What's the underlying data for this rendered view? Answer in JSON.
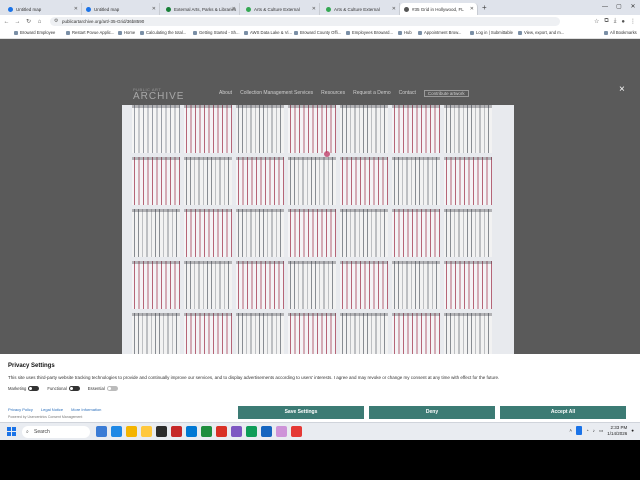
{
  "browser": {
    "tabs": [
      {
        "label": "Untitled map",
        "icon": "maps-icon",
        "color": "#1a73e8",
        "active": false
      },
      {
        "label": "Untitled map",
        "icon": "maps-icon",
        "color": "#1a73e8",
        "active": false
      },
      {
        "label": "External Arts, Parks & Libraries",
        "icon": "sheets-icon",
        "color": "#188038",
        "active": false
      },
      {
        "label": "Arts & Culture External",
        "icon": "sheets-icon",
        "color": "#34a853",
        "active": false
      },
      {
        "label": "Arts & Culture External",
        "icon": "sheets-icon",
        "color": "#34a853",
        "active": false
      },
      {
        "label": "#35 Grid in Hollywood, FL",
        "icon": "page-icon",
        "color": "#555555",
        "active": true
      }
    ],
    "url": "publicartarchive.org/art/-35-Grid/36b8590",
    "bookmarks": [
      "Broward Employee",
      "Restart Povue Applic...",
      "Home",
      "Calculating the total...",
      "Getting Started - Sh...",
      "AWS Data Lake & Vi...",
      "Broward County Offi...",
      "Employees Broward...",
      "Hub",
      "Appointment Brow...",
      "Log in | Submittable",
      "View, export, and m..."
    ],
    "all_bookmarks_label": "All Bookmarks"
  },
  "site": {
    "logo_small": "PUBLIC ART",
    "logo": "ARCHIVE",
    "nav": [
      "About",
      "Collection Management Services",
      "Resources",
      "Request a Demo",
      "Contact"
    ],
    "contribute_label": "Contribute artwork",
    "close_label": "×"
  },
  "artwork": {
    "rows": [
      [
        "mix",
        "pink",
        "grey",
        "pink",
        "grey",
        "pink",
        "grey"
      ],
      [
        "pink",
        "grey",
        "pink",
        "grey",
        "pink",
        "grey",
        "pink"
      ],
      [
        "grey",
        "pink",
        "grey",
        "pink",
        "grey",
        "pink",
        "grey"
      ],
      [
        "pink",
        "grey",
        "pink",
        "grey",
        "pink",
        "grey",
        "pink"
      ],
      [
        "grey",
        "pink",
        "grey",
        "pink",
        "grey",
        "pink",
        "grey"
      ]
    ]
  },
  "privacy": {
    "title": "Privacy Settings",
    "text": "This site uses third-party website tracking technologies to provide and continually improve our services, and to display advertisements according to users' interests. I agree and may revoke or change my consent at any time with effect for the future.",
    "toggles": [
      {
        "label": "Marketing",
        "enabled": true
      },
      {
        "label": "Functional",
        "enabled": true
      },
      {
        "label": "Essential",
        "enabled": false
      }
    ],
    "links": [
      "Privacy Policy",
      "Legal Notice",
      "More Information"
    ],
    "powered": "Powered by Usercentrics Consent Management",
    "buttons": {
      "save": "Save Settings",
      "deny": "Deny",
      "accept": "Accept All"
    },
    "button_color": "#3c7b74"
  },
  "taskbar": {
    "search_placeholder": "Search",
    "apps": [
      "#3a7bd5",
      "#1e88e5",
      "#f4b400",
      "#ffc83d",
      "#2b2b2b",
      "#c62828",
      "#0078d4",
      "#1e8e3e",
      "#d93025",
      "#7e57c2",
      "#0f9d58",
      "#1565c0",
      "#ce93d8",
      "#e53935"
    ],
    "time": "2:33 PM",
    "date": "1/14/2026"
  }
}
